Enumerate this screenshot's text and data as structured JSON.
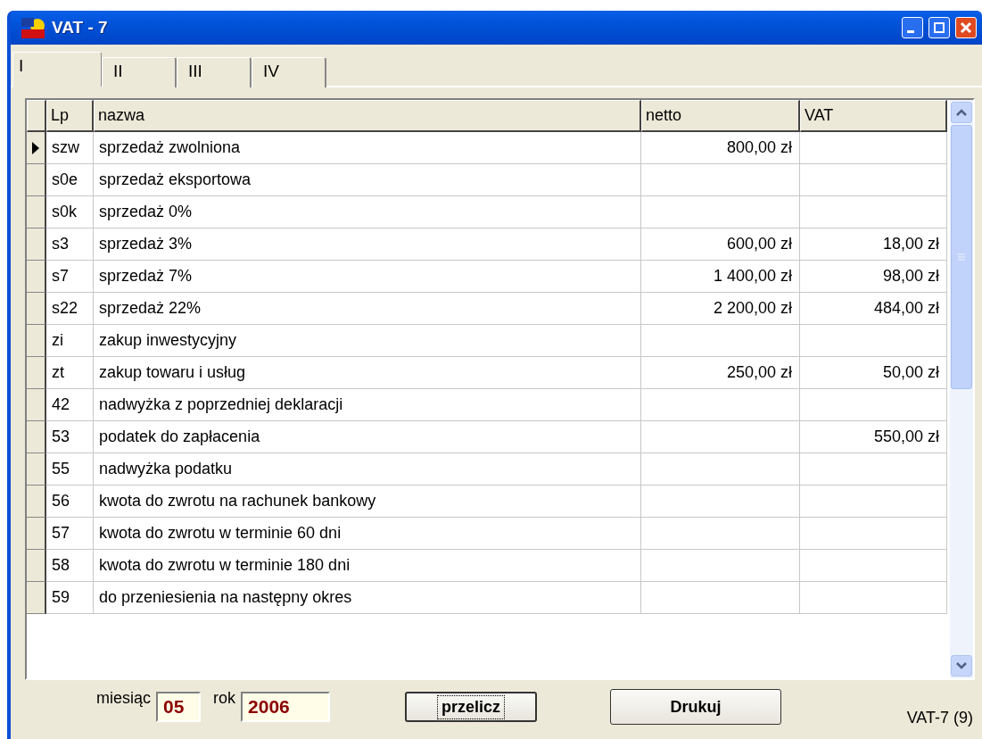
{
  "window": {
    "title": "VAT - 7"
  },
  "tabs": [
    {
      "label": "I",
      "selected": true
    },
    {
      "label": "II",
      "selected": false
    },
    {
      "label": "III",
      "selected": false
    },
    {
      "label": "IV",
      "selected": false
    }
  ],
  "table": {
    "columns": [
      "Lp",
      "nazwa",
      "netto",
      "VAT"
    ],
    "rows": [
      {
        "lp": "szw",
        "nazwa": "sprzedaż zwolniona",
        "netto": "800,00 zł",
        "vat": "",
        "selected": true
      },
      {
        "lp": "s0e",
        "nazwa": "sprzedaż eksportowa",
        "netto": "",
        "vat": "",
        "selected": false
      },
      {
        "lp": "s0k",
        "nazwa": "sprzedaż 0%",
        "netto": "",
        "vat": "",
        "selected": false
      },
      {
        "lp": "s3",
        "nazwa": "sprzedaż 3%",
        "netto": "600,00 zł",
        "vat": "18,00 zł",
        "selected": false
      },
      {
        "lp": "s7",
        "nazwa": "sprzedaż 7%",
        "netto": "1 400,00 zł",
        "vat": "98,00 zł",
        "selected": false
      },
      {
        "lp": "s22",
        "nazwa": "sprzedaż 22%",
        "netto": "2 200,00 zł",
        "vat": "484,00 zł",
        "selected": false
      },
      {
        "lp": "zi",
        "nazwa": "zakup inwestycyjny",
        "netto": "",
        "vat": "",
        "selected": false
      },
      {
        "lp": "zt",
        "nazwa": "zakup towaru i usług",
        "netto": "250,00 zł",
        "vat": "50,00 zł",
        "selected": false
      },
      {
        "lp": "42",
        "nazwa": "nadwyżka z poprzedniej deklaracji",
        "netto": "",
        "vat": "",
        "selected": false
      },
      {
        "lp": "53",
        "nazwa": "podatek do zapłacenia",
        "netto": "",
        "vat": "550,00 zł",
        "selected": false
      },
      {
        "lp": "55",
        "nazwa": "nadwyżka podatku",
        "netto": "",
        "vat": "",
        "selected": false
      },
      {
        "lp": "56",
        "nazwa": "kwota do zwrotu na rachunek bankowy",
        "netto": "",
        "vat": "",
        "selected": false
      },
      {
        "lp": "57",
        "nazwa": "kwota do zwrotu w terminie 60 dni",
        "netto": "",
        "vat": "",
        "selected": false
      },
      {
        "lp": "58",
        "nazwa": "kwota do zwrotu w terminie 180 dni",
        "netto": "",
        "vat": "",
        "selected": false
      },
      {
        "lp": "59",
        "nazwa": "do przeniesienia na następny okres",
        "netto": "",
        "vat": "",
        "selected": false
      }
    ]
  },
  "footer": {
    "month_label": "miesiąc",
    "month_value": "05",
    "year_label": "rok",
    "year_value": "2006",
    "buttons": [
      {
        "label": "przelicz",
        "focused": true
      },
      {
        "label": "Drukuj",
        "focused": false
      }
    ],
    "status": "VAT-7 (9)"
  }
}
